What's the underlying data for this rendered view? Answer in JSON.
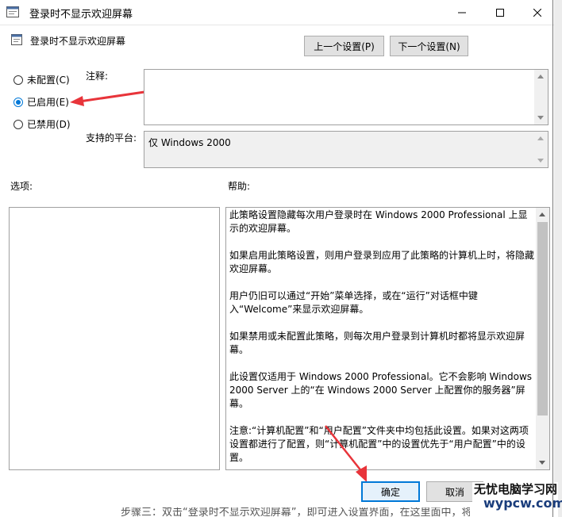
{
  "window": {
    "title": "登录时不显示欢迎屏幕"
  },
  "header": {
    "policy_name": "登录时不显示欢迎屏幕",
    "prev_button": "上一个设置(P)",
    "next_button": "下一个设置(N)"
  },
  "options": {
    "not_configured": "未配置(C)",
    "enabled": "已启用(E)",
    "disabled": "已禁用(D)",
    "selected": "enabled"
  },
  "comment": {
    "label": "注释:",
    "value": ""
  },
  "platform": {
    "label": "支持的平台:",
    "value": "仅 Windows 2000"
  },
  "sections": {
    "options_label": "选项:",
    "help_label": "帮助:"
  },
  "help": {
    "paragraphs": [
      "此策略设置隐藏每次用户登录时在 Windows 2000 Professional 上显示的欢迎屏幕。",
      "如果启用此策略设置，则用户登录到应用了此策略的计算机上时，将隐藏欢迎屏幕。",
      "用户仍旧可以通过“开始”菜单选择，或在“运行”对话框中键入“Welcome”来显示欢迎屏幕。",
      "如果禁用或未配置此策略，则每次用户登录到计算机时都将显示欢迎屏幕。",
      "此设置仅适用于 Windows 2000 Professional。它不会影响 Windows 2000 Server 上的“在 Windows 2000 Server 上配置你的服务器”屏幕。",
      "注意:“计算机配置”和“用户配置”文件夹中均包括此设置。如果对这两项设置都进行了配置，则“计算机配置”中的设置优先于“用户配置”中的设置。"
    ]
  },
  "buttons": {
    "ok": "确定",
    "cancel": "取消"
  },
  "footer": {
    "text": "步骤三：双击“登录时不显示欢迎屏幕”，即可进入设置界面，在这里面中，将"
  },
  "watermark": {
    "line1": "无忧电脑学习网",
    "line2": "wypcw.com"
  },
  "colors": {
    "accent": "#0078d7",
    "arrow": "#e8343a"
  }
}
